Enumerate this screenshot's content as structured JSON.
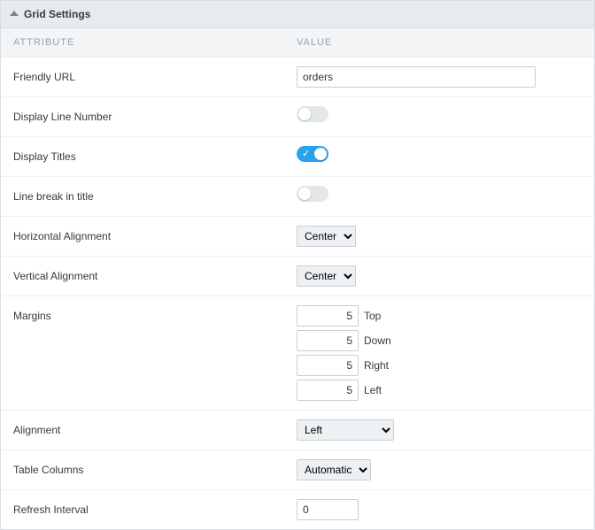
{
  "panel": {
    "title": "Grid Settings",
    "columns": {
      "attribute": "ATTRIBUTE",
      "value": "VALUE"
    }
  },
  "rows": {
    "friendly_url": {
      "label": "Friendly URL",
      "value": "orders"
    },
    "display_line_number": {
      "label": "Display Line Number",
      "on": false
    },
    "display_titles": {
      "label": "Display Titles",
      "on": true
    },
    "line_break_in_title": {
      "label": "Line break in title",
      "on": false
    },
    "horizontal_alignment": {
      "label": "Horizontal Alignment",
      "value": "Center"
    },
    "vertical_alignment": {
      "label": "Vertical Alignment",
      "value": "Center"
    },
    "margins": {
      "label": "Margins",
      "top": {
        "value": "5",
        "label": "Top"
      },
      "down": {
        "value": "5",
        "label": "Down"
      },
      "right": {
        "value": "5",
        "label": "Right"
      },
      "left": {
        "value": "5",
        "label": "Left"
      }
    },
    "alignment": {
      "label": "Alignment",
      "value": "Left"
    },
    "table_columns": {
      "label": "Table Columns",
      "value": "Automatic"
    },
    "refresh_interval": {
      "label": "Refresh Interval",
      "value": "0"
    }
  }
}
